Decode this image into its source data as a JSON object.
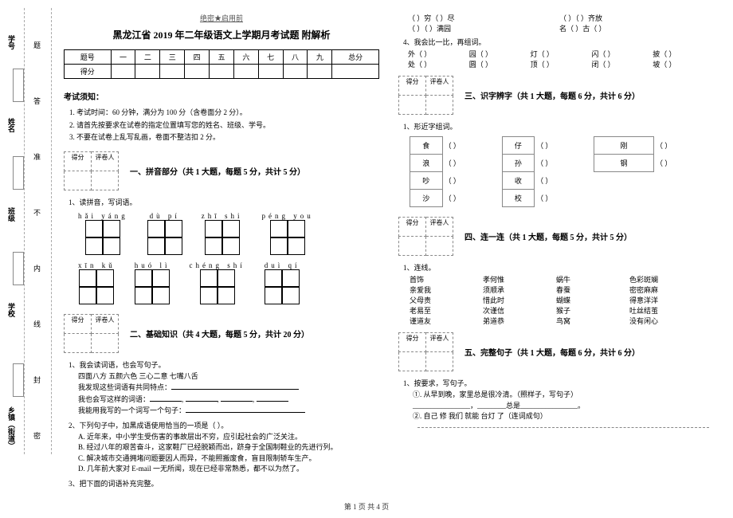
{
  "meta": {
    "secret": "绝密★启用前"
  },
  "title": "黑龙江省 2019 年二年级语文上学期月考试题 附解析",
  "score_header": [
    "题号",
    "一",
    "二",
    "三",
    "四",
    "五",
    "六",
    "七",
    "八",
    "九",
    "总分"
  ],
  "score_row_label": "得分",
  "notes_title": "考试须知：",
  "notes": [
    "考试时间：60 分钟，满分为 100 分（含卷面分 2 分）。",
    "请首先按要求在试卷的指定位置填写您的姓名、班级、学号。",
    "不要在试卷上乱写乱画，卷面不整洁扣 2 分。"
  ],
  "scorebox": {
    "c1": "得分",
    "c2": "评卷人"
  },
  "sections": {
    "s1": "一、拼音部分（共 1 大题，每题 5 分，共计 5 分）",
    "s2": "二、基础知识（共 4 大题，每题 5 分，共计 20 分）",
    "s3": "三、识字辨字（共 1 大题，每题 6 分，共计 6 分）",
    "s4": "四、连一连（共 1 大题，每题 5 分，共计 5 分）",
    "s5": "五、完整句子（共 1 大题，每题 6 分，共计 6 分）"
  },
  "q1": {
    "prompt": "1、读拼音，写词语。",
    "pinyins": [
      "hǎi  yáng",
      "dù   pí",
      "zhī  shi",
      "péng  you",
      "xīn  kǔ",
      "huó  lì",
      "chéng shí",
      "duì  qí"
    ]
  },
  "q2": {
    "p1": "1、我会读词语，也会写句子。",
    "line1": "四面八方    五颜六色    三心二意    七嘴八舌",
    "line2": "我发现这些词语有共同特点：",
    "line3": "我也会写这样的词语：",
    "line4": "我能用我写的一个词写一个句子："
  },
  "q3": {
    "prompt": "2、下列句子中，加黑成语使用恰当的一项是（     ）。",
    "A": "A. 近年来，中小学生受伤害的事故层出不穷，应引起社会的广泛关注。",
    "B": "B. 经过八年的艰苦奋斗，这家鞋厂已经脱颖而出，跻身于全国制鞋业的先进行列。",
    "C": "C. 解决城市交通拥堵问题要因人而异，不能照搬废食，盲目限制轿车生产。",
    "D": "D. 几年前大家对 E-mail 一无所闻，现在已经非常熟悉，都不以为然了。"
  },
  "q4": {
    "prompt": "3、把下面的词语补充完整。"
  },
  "fill": {
    "r1": [
      "（    ）穷（    ）尽",
      "（    ）（    ）齐放"
    ],
    "r2": [
      "（    ）（    ）满园",
      "名（    ）古（    ）"
    ],
    "prompt": "4、我会比一比，再组词。",
    "pairs": [
      [
        "外（    ）",
        "园（    ）",
        "灯（    ）",
        "闪（    ）",
        "披（    ）"
      ],
      [
        "处（    ）",
        "圆（    ）",
        "顶（    ）",
        "闭（    ）",
        "坡（    ）"
      ]
    ]
  },
  "q5": {
    "prompt": "1、形近字组词。",
    "rows": [
      [
        "食",
        "仔",
        "刚"
      ],
      [
        "浪",
        "孙",
        "钢"
      ],
      [
        "吵",
        "收",
        ""
      ],
      [
        "沙",
        "校",
        ""
      ]
    ]
  },
  "q6": {
    "prompt": "1、连线。",
    "rows": [
      [
        "首饰",
        "孝何惟",
        "蜗牛",
        "色彩斑斓"
      ],
      [
        "亲爱我",
        "须顺承",
        "春蚕",
        "密密麻麻"
      ],
      [
        "父母责",
        "惜此时",
        "蝴蝶",
        "得意洋洋"
      ],
      [
        "老易至",
        "次谨信",
        "猴子",
        "吐丝结茧"
      ],
      [
        "谨道友",
        "弟道恭",
        "鸟窝",
        "没有闲心"
      ]
    ]
  },
  "q7": {
    "prompt": "1、按要求，写句子。",
    "l1": "①. 从早到晚，家里总是很冷清。（照样子，写句子）",
    "l2blank": "________________，________总是________________。",
    "l3": "②. 自己  修  我们  就能  台灯 了（连词成句）"
  },
  "footer": "第 1 页 共 4 页",
  "rail": {
    "labels": [
      "乡镇（街道）",
      "学校",
      "班级",
      "姓名",
      "学号"
    ],
    "chars": [
      "密",
      "封",
      "线",
      "内",
      "不",
      "准",
      "答",
      "题"
    ]
  }
}
